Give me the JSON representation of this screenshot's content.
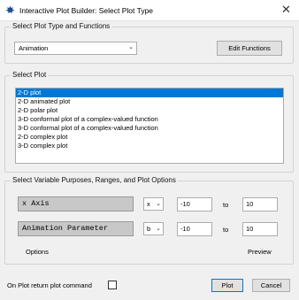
{
  "window": {
    "title": "Interactive Plot Builder: Select Plot Type",
    "close_glyph": "✕"
  },
  "plot_type_group": {
    "label": "Select Plot Type and Functions",
    "selected_type": "Animation",
    "edit_functions_label": "Edit Functions"
  },
  "plot_group": {
    "label": "Select Plot",
    "items": [
      "2-D plot",
      "2-D animated plot",
      "2-D polar plot",
      "3-D conformal plot of a complex-valued function",
      "3-D conformal plot of a complex-valued function",
      "2-D complex plot",
      "3-D complex plot"
    ],
    "selected_index": 0
  },
  "variables_group": {
    "label": "Select Variable Purposes, Ranges, and Plot Options",
    "rows": [
      {
        "purpose": "x Axis",
        "variable": "x",
        "from": "-10",
        "to_label": "to",
        "to": "10"
      },
      {
        "purpose": "Animation Parameter",
        "variable": "b",
        "from": "-10",
        "to_label": "to",
        "to": "10"
      }
    ],
    "options_label": "Options",
    "preview_label": "Preview"
  },
  "footer": {
    "return_command_label": "On Plot return plot command",
    "return_command_checked": false,
    "plot_label": "Plot",
    "cancel_label": "Cancel"
  },
  "colors": {
    "selection": "#0078d7",
    "default_button_border": "#0078d7"
  },
  "icons": {
    "app": "maple-leaf-icon",
    "dropdown": "chevron-down-icon"
  }
}
